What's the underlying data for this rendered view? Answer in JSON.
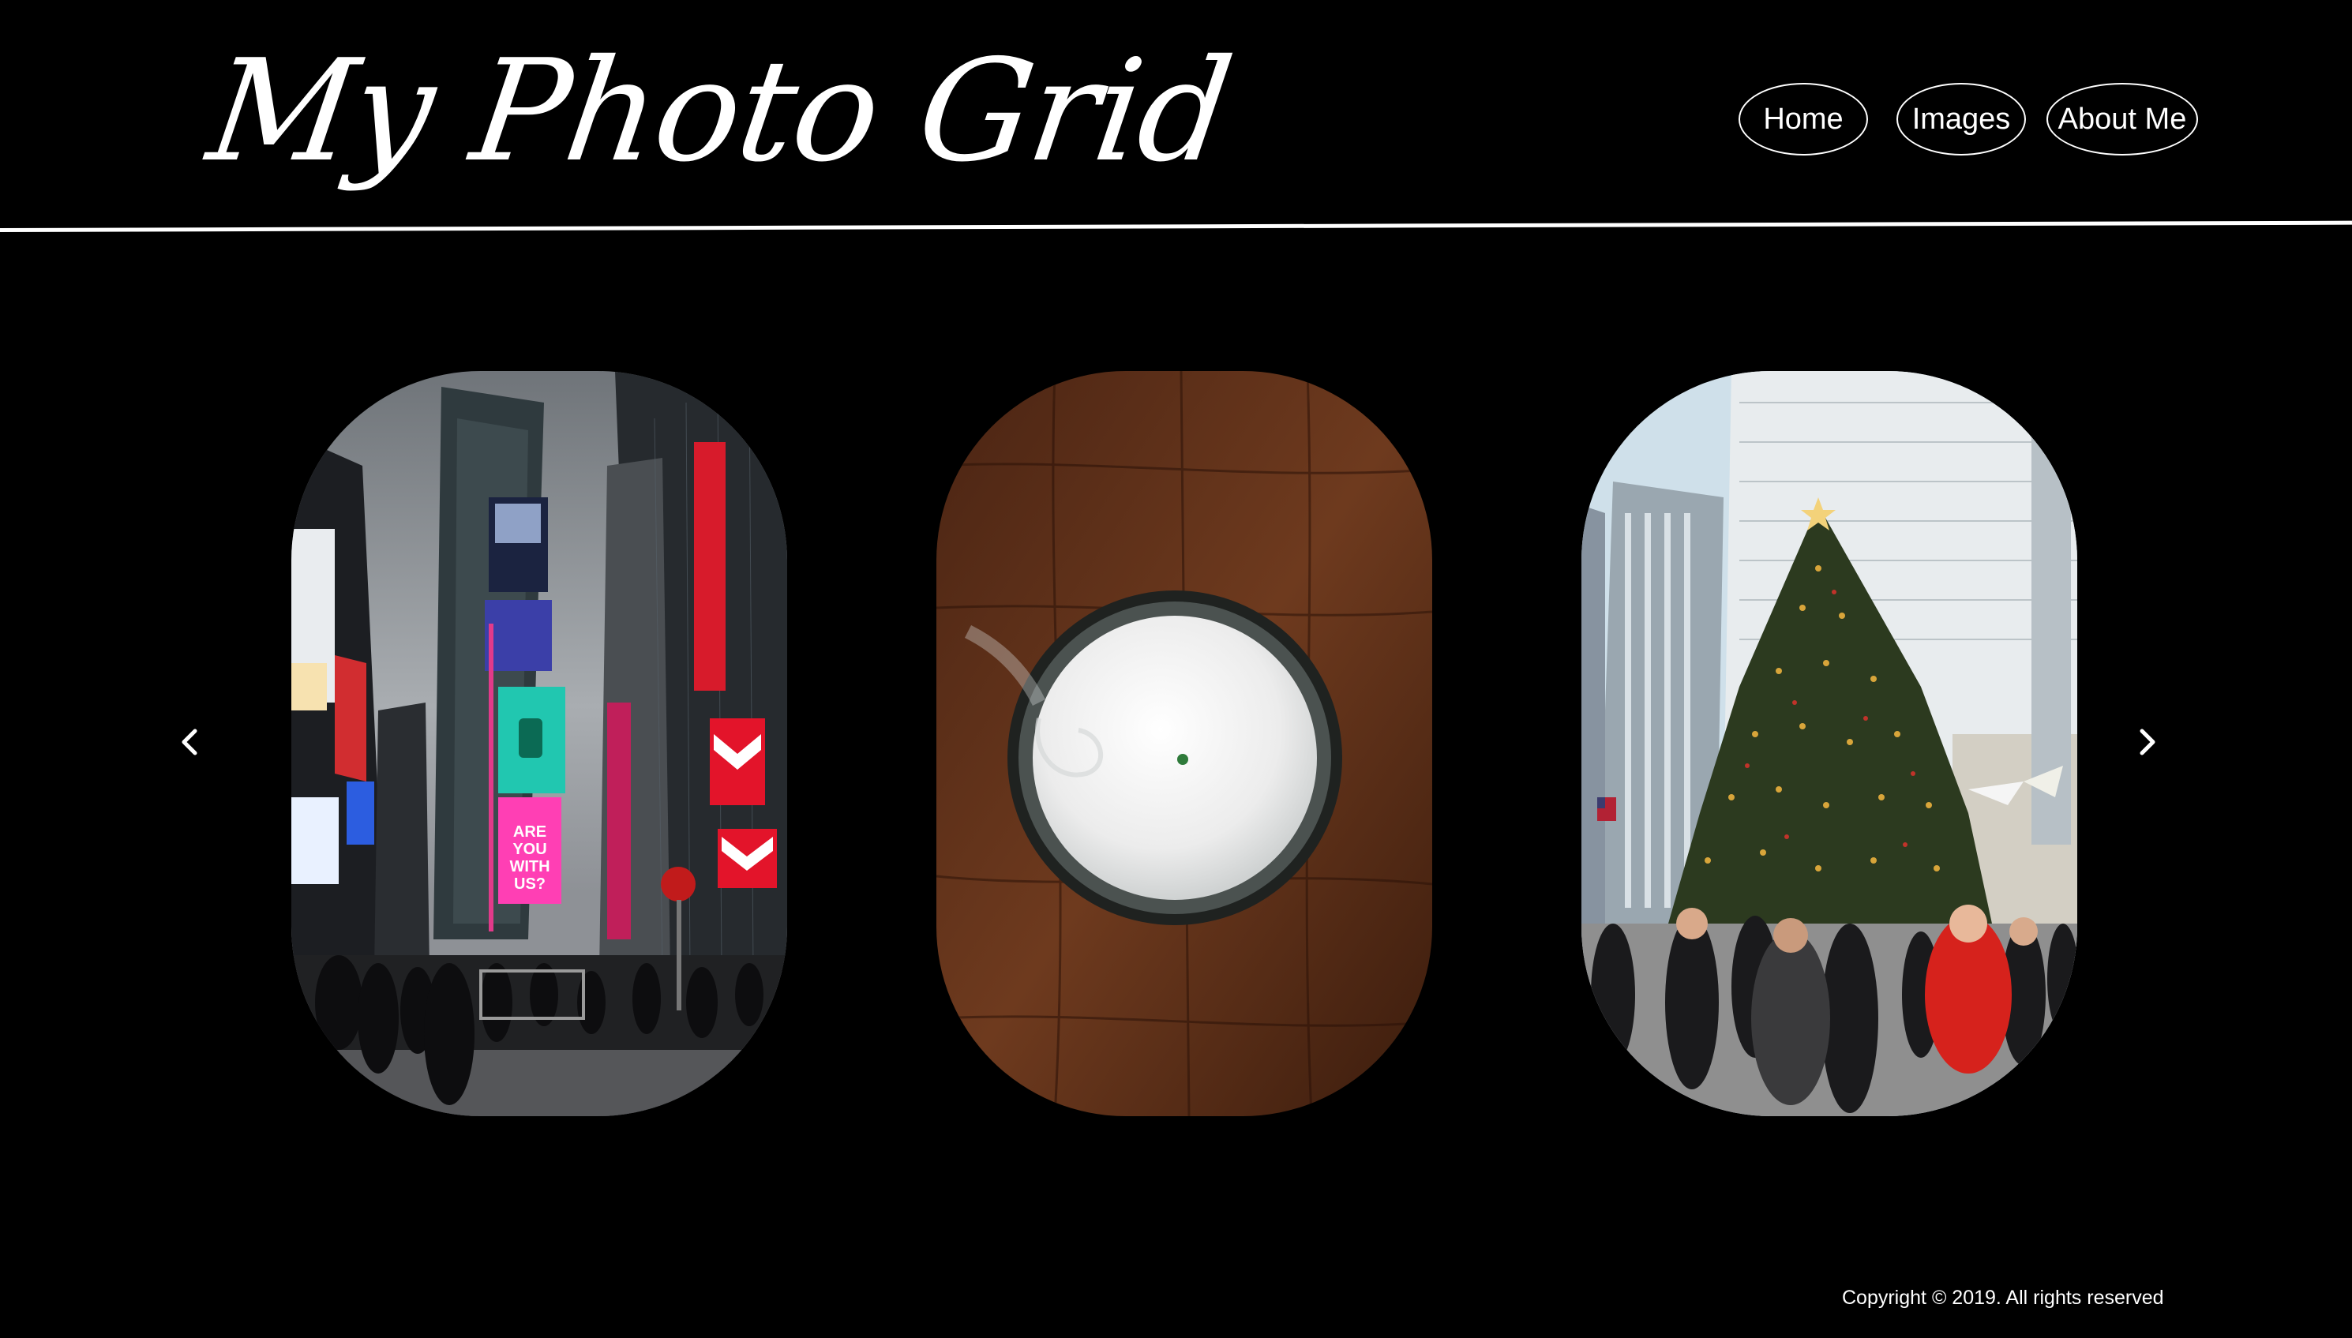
{
  "header": {
    "title": "My Photo Grid",
    "nav": [
      {
        "label": "Home"
      },
      {
        "label": "Images"
      },
      {
        "label": "About Me"
      }
    ]
  },
  "carousel": {
    "prev_icon": "chevron-left-icon",
    "next_icon": "chevron-right-icon",
    "slides": [
      {
        "subject": "times-square-photo",
        "billboard_text": "ARE YOU WITH US?"
      },
      {
        "subject": "candle-photo"
      },
      {
        "subject": "christmas-tree-photo"
      }
    ]
  },
  "footer": {
    "copyright": "Copyright © 2019. All rights reserved"
  },
  "colors": {
    "background": "#000000",
    "foreground": "#ffffff"
  }
}
